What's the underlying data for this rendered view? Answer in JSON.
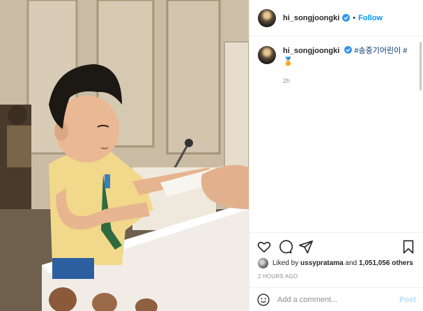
{
  "post": {
    "username": "hi_songjoongki",
    "follow_label": "Follow",
    "separator": "•",
    "caption": {
      "username": "hi_songjoongki",
      "hashtags": "#송중기어린이 #",
      "emoji": "🏅",
      "time": "2h"
    },
    "likes": {
      "prefix": "Liked by ",
      "user": "ussypratama",
      "middle": " and ",
      "count": "1,051,056 others"
    },
    "posted_ago": "2 HOURS AGO",
    "comment": {
      "placeholder": "Add a comment...",
      "post_label": "Post"
    },
    "icons": [
      "heart-icon",
      "comment-icon",
      "share-icon",
      "bookmark-icon",
      "emoji-icon",
      "verified-icon"
    ],
    "colors": {
      "link": "#0095f6",
      "hashtag": "#00376b",
      "muted": "#8e8e8e",
      "post_disabled": "#b2dffc"
    }
  }
}
